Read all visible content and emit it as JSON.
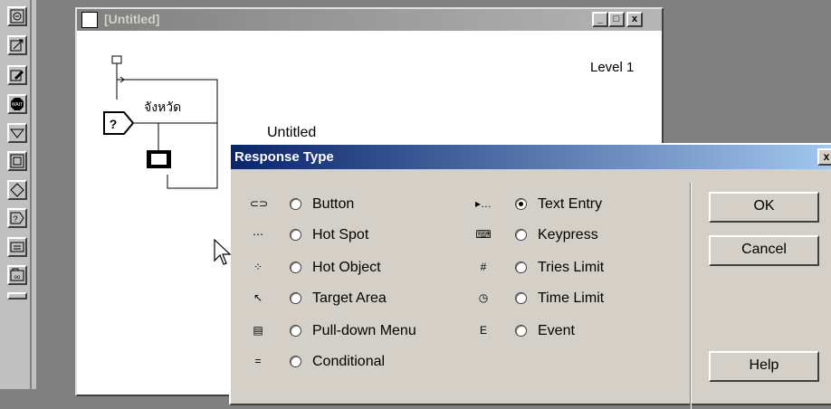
{
  "flow_window": {
    "title": "[Untitled]",
    "minimize": "_",
    "maximize": "□",
    "close": "x",
    "level": "Level 1",
    "icon_label": "จังหวัด",
    "untitled_label": "Untitled"
  },
  "palette": {
    "tools": [
      "display-icon",
      "animation-icon",
      "erase-icon",
      "wait-icon",
      "navigate-icon",
      "framework-icon",
      "decision-icon",
      "interaction-icon",
      "calculation-icon",
      "map-icon",
      "more-icon"
    ]
  },
  "dialog": {
    "title": "Response Type",
    "close": "x",
    "options_left": [
      {
        "symbol": "⊂⊃",
        "label": "Button",
        "selected": false
      },
      {
        "symbol": "⋯",
        "label": "Hot Spot",
        "selected": false
      },
      {
        "symbol": "⁘",
        "label": "Hot Object",
        "selected": false
      },
      {
        "symbol": "↖",
        "label": "Target Area",
        "selected": false
      },
      {
        "symbol": "▤",
        "label": "Pull-down Menu",
        "selected": false
      },
      {
        "symbol": "=",
        "label": "Conditional",
        "selected": false
      }
    ],
    "options_right": [
      {
        "symbol": "▸…",
        "label": "Text Entry",
        "selected": true
      },
      {
        "symbol": "⌨",
        "label": "Keypress",
        "selected": false
      },
      {
        "symbol": "#",
        "label": "Tries Limit",
        "selected": false
      },
      {
        "symbol": "◷",
        "label": "Time Limit",
        "selected": false
      },
      {
        "symbol": "E",
        "label": "Event",
        "selected": false
      }
    ],
    "ok": "OK",
    "cancel": "Cancel",
    "help": "Help"
  }
}
